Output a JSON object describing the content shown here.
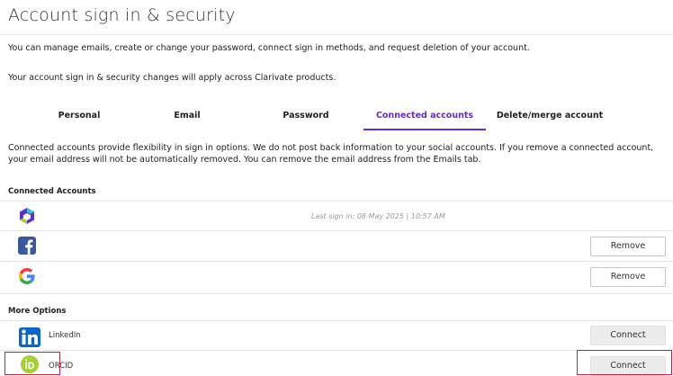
{
  "page": {
    "title": "Account sign in & security",
    "intro": "You can manage emails, create or change your password, connect sign in methods, and request deletion of your account.",
    "note": "Your account sign in & security changes will apply across Clarivate products."
  },
  "tabs": [
    {
      "label": "Personal",
      "active": false
    },
    {
      "label": "Email",
      "active": false
    },
    {
      "label": "Password",
      "active": false
    },
    {
      "label": "Connected accounts",
      "active": true
    },
    {
      "label": "Delete/merge account",
      "active": false
    }
  ],
  "connected": {
    "description": "Connected accounts provide flexibility in sign in options. We do not post back information to your social accounts. If you remove a connected account, your email address will not be automatically removed. You can remove the email address from the Emails tab.",
    "heading": "Connected Accounts",
    "accounts": [
      {
        "icon": "clarivate-icon",
        "last_sign_in": "Last sign in: 08 May 2025 | 10:57 AM"
      },
      {
        "icon": "facebook-icon",
        "button": "Remove"
      },
      {
        "icon": "google-icon",
        "button": "Remove"
      }
    ]
  },
  "more_options": {
    "heading": "More Options",
    "items": [
      {
        "icon": "linkedin-icon",
        "label": "LinkedIn",
        "button": "Connect"
      },
      {
        "icon": "orcid-icon",
        "label": "ORCID",
        "button": "Connect"
      }
    ]
  },
  "colors": {
    "accent": "#5e33bf",
    "highlight": "#b02a37",
    "facebook": "#3b5998",
    "linkedin": "#0a66c2",
    "orcid": "#a6ce39"
  }
}
